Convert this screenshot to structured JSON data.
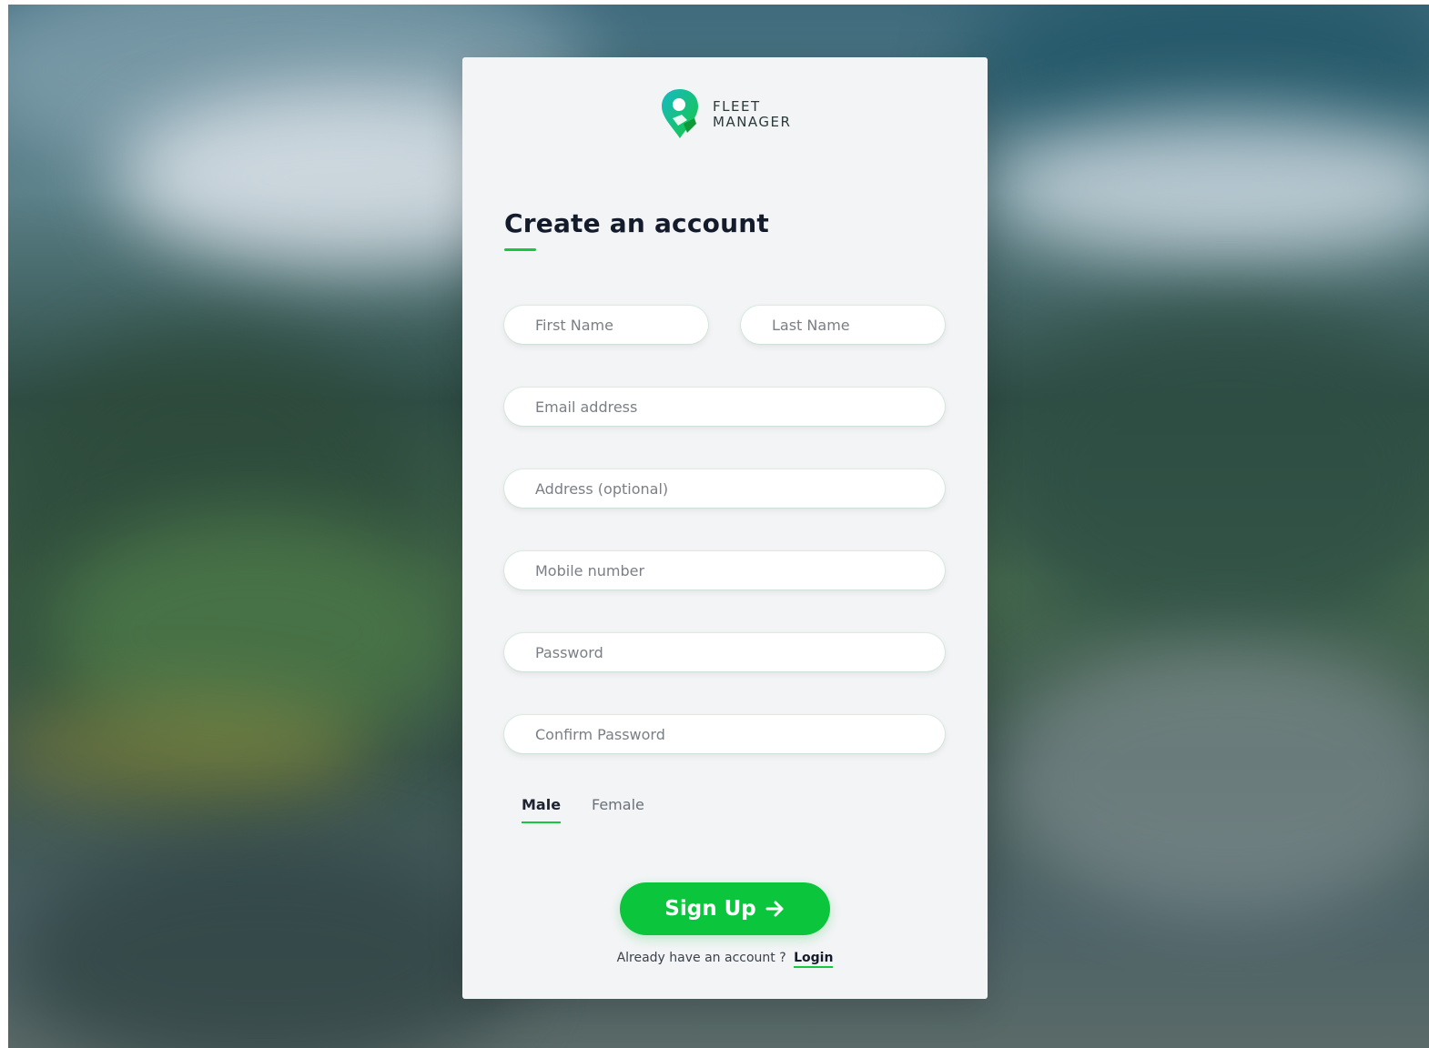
{
  "brand": {
    "line1": "FLEET",
    "line2": "MANAGER",
    "accent_color": "#15c83e",
    "icon": "map-pin-logo-icon"
  },
  "form": {
    "title": "Create an account",
    "fields": {
      "first_name": {
        "placeholder": "First Name",
        "value": ""
      },
      "last_name": {
        "placeholder": "Last Name",
        "value": ""
      },
      "email": {
        "placeholder": "Email address",
        "value": ""
      },
      "address": {
        "placeholder": "Address (optional)",
        "value": ""
      },
      "mobile": {
        "placeholder": "Mobile number",
        "value": ""
      },
      "password": {
        "placeholder": "Password",
        "value": ""
      },
      "confirm_password": {
        "placeholder": "Confirm Password",
        "value": ""
      }
    },
    "gender": {
      "options": [
        "Male",
        "Female"
      ],
      "selected": "Male"
    },
    "submit_label": "Sign Up",
    "submit_icon": "arrow-right-icon",
    "footer_text": "Already have an account ?",
    "login_label": "Login"
  }
}
